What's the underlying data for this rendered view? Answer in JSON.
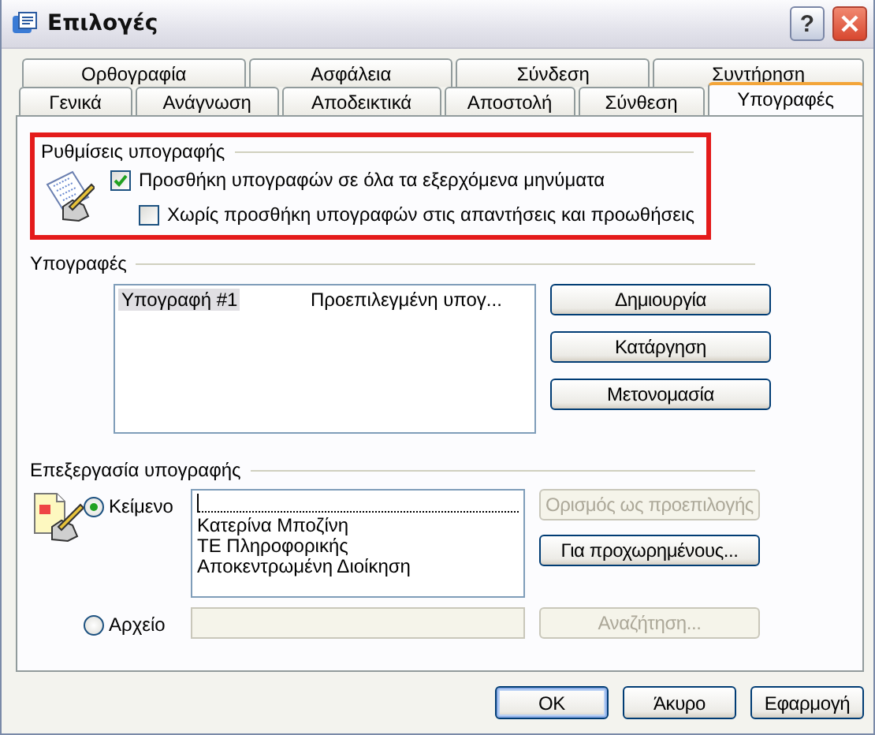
{
  "window": {
    "title": "Επιλογές",
    "help": "?"
  },
  "tab_rows": [
    {
      "tabs": [
        {
          "label": "Ορθογραφία",
          "selected": false
        },
        {
          "label": "Ασφάλεια",
          "selected": false
        },
        {
          "label": "Σύνδεση",
          "selected": false
        },
        {
          "label": "Συντήρηση",
          "selected": false
        }
      ]
    },
    {
      "tabs": [
        {
          "label": "Γενικά",
          "selected": false
        },
        {
          "label": "Ανάγνωση",
          "selected": false
        },
        {
          "label": "Αποδεικτικά",
          "selected": false
        },
        {
          "label": "Αποστολή",
          "selected": false
        },
        {
          "label": "Σύνθεση",
          "selected": false
        },
        {
          "label": "Υπογραφές",
          "selected": true
        }
      ]
    }
  ],
  "signature_settings": {
    "title": "Ρυθμίσεις υπογραφής",
    "highlighted": true,
    "options": [
      {
        "label": "Προσθήκη υπογραφών σε όλα τα εξερχόμενα μηνύματα",
        "checked": true,
        "children": [
          {
            "label": "Χωρίς προσθήκη υπογραφών στις απαντήσεις και προωθήσεις",
            "checked": false
          }
        ]
      }
    ]
  },
  "signatures": {
    "title": "Υπογραφές",
    "rows": [
      {
        "name": "Υπογραφή #1",
        "description": "Προεπιλεγμένη υπογ...",
        "selected": true
      }
    ],
    "buttons": [
      {
        "label": "Δημιουργία",
        "disabled": false
      },
      {
        "label": "Κατάργηση",
        "disabled": false
      },
      {
        "label": "Μετονομασία",
        "disabled": false
      }
    ]
  },
  "edit_signature": {
    "title": "Επεξεργασία υπογραφής",
    "options": [
      {
        "kind": "text",
        "label": "Κείμενο",
        "selected": true,
        "lines": [
          "Κατερίνα Μποζίνη",
          "ΤΕ Πληροφορικής",
          "Αποκεντρωμένη Διοίκηση"
        ],
        "buttons": [
          {
            "label": "Ορισμός ως προεπιλογής",
            "disabled": true
          },
          {
            "label": "Για προχωρημένους...",
            "disabled": false
          }
        ]
      },
      {
        "kind": "file",
        "label": "Αρχείο",
        "selected": false,
        "buttons": [
          {
            "label": "Αναζήτηση...",
            "disabled": true
          }
        ]
      }
    ]
  },
  "footer_buttons": [
    {
      "label": "OK",
      "default": true
    },
    {
      "label": "Άκυρο",
      "default": false
    },
    {
      "label": "Εφαρμογή",
      "default": false
    }
  ]
}
